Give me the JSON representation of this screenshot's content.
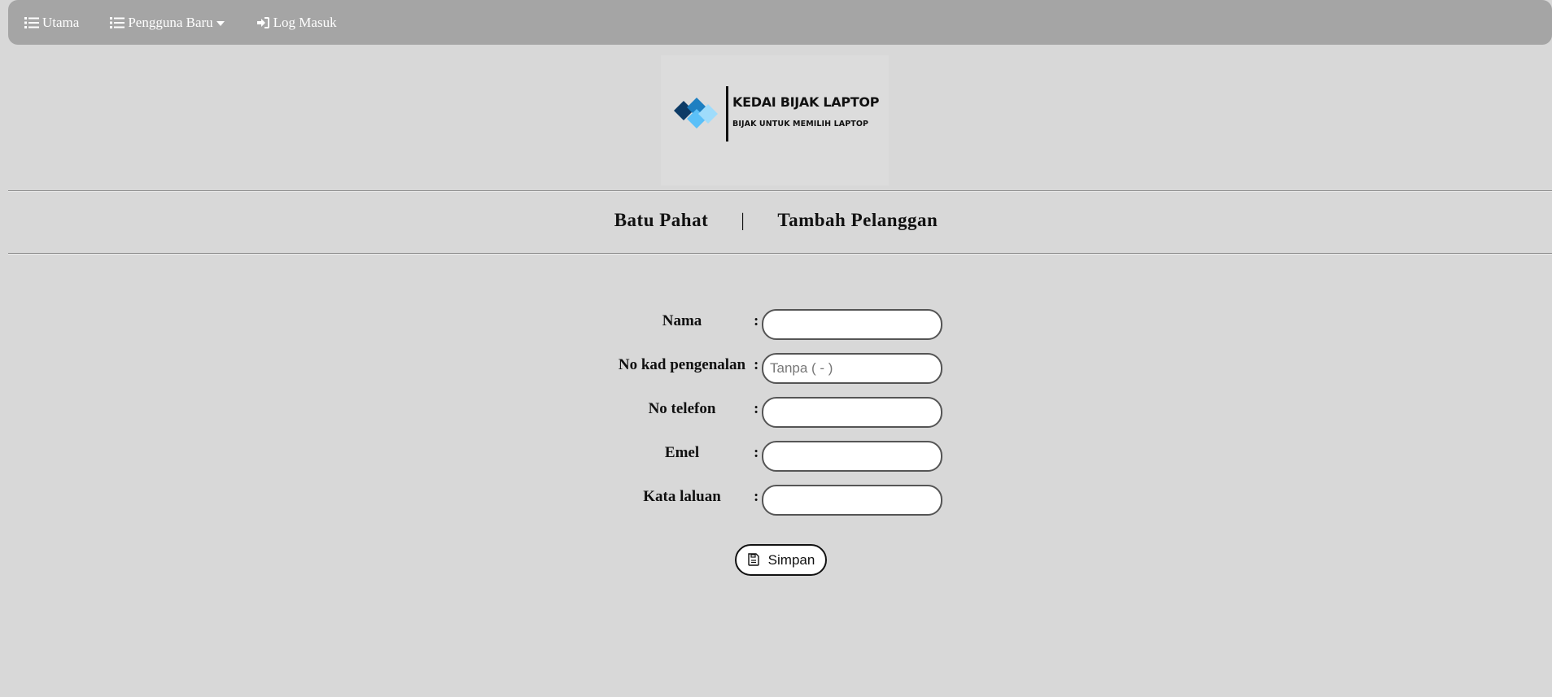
{
  "nav": {
    "items": [
      {
        "label": "Utama",
        "icon": "list-icon"
      },
      {
        "label": "Pengguna Baru",
        "icon": "list-icon",
        "dropdown": true
      },
      {
        "label": "Log Masuk",
        "icon": "sign-in-icon"
      }
    ]
  },
  "logo": {
    "title": "KEDAI BIJAK LAPTOP",
    "subtitle": "BIJAK UNTUK MEMILIH LAPTOP",
    "colors": {
      "dark": "#0d3b66",
      "mid": "#1d7fc1",
      "light": "#5bc0f8"
    }
  },
  "header": {
    "location": "Batu Pahat",
    "separator": "|",
    "page": "Tambah Pelanggan"
  },
  "form": {
    "colon": ":",
    "fields": [
      {
        "label": "Nama",
        "value": "",
        "placeholder": ""
      },
      {
        "label": "No kad pengenalan",
        "value": "",
        "placeholder": "Tanpa ( - )"
      },
      {
        "label": "No telefon",
        "value": "",
        "placeholder": ""
      },
      {
        "label": "Emel",
        "value": "",
        "placeholder": ""
      },
      {
        "label": "Kata laluan",
        "value": "",
        "placeholder": ""
      }
    ],
    "submit_label": "Simpan",
    "submit_icon": "save-icon"
  },
  "colors": {
    "background": "#d8d8d8",
    "navbar": "#a5a5a5",
    "nav_text": "#ffffff"
  }
}
